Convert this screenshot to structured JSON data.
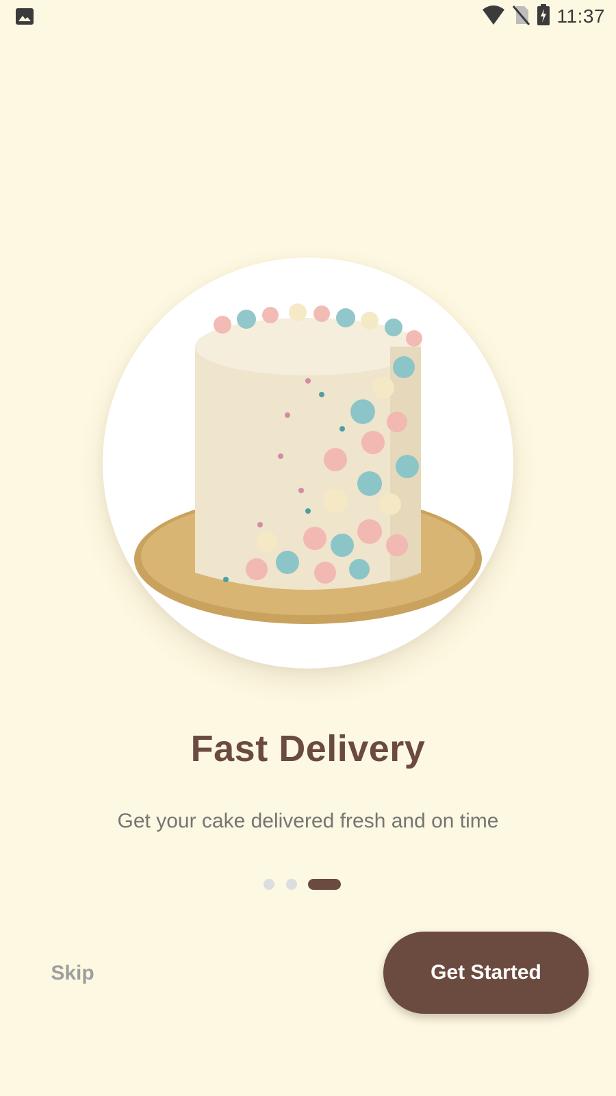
{
  "status_bar": {
    "time": "11:37",
    "left_icon": "image-notification-icon",
    "icons": [
      "wifi-icon",
      "no-sim-icon",
      "battery-charging-icon"
    ]
  },
  "onboarding": {
    "image": "layered-cake-with-pastel-buttercream-petals",
    "title": "Fast Delivery",
    "subtitle": "Get your cake delivered fresh and on time",
    "page_indicator": {
      "total": 3,
      "active_index": 2
    },
    "skip_label": "Skip",
    "primary_button_label": "Get Started"
  },
  "colors": {
    "background": "#FDF8E1",
    "brand_brown": "#6B4A3F",
    "muted_text": "#757575",
    "skip_text": "#9E9E9E",
    "inactive_dot": "#DCDDE2"
  }
}
